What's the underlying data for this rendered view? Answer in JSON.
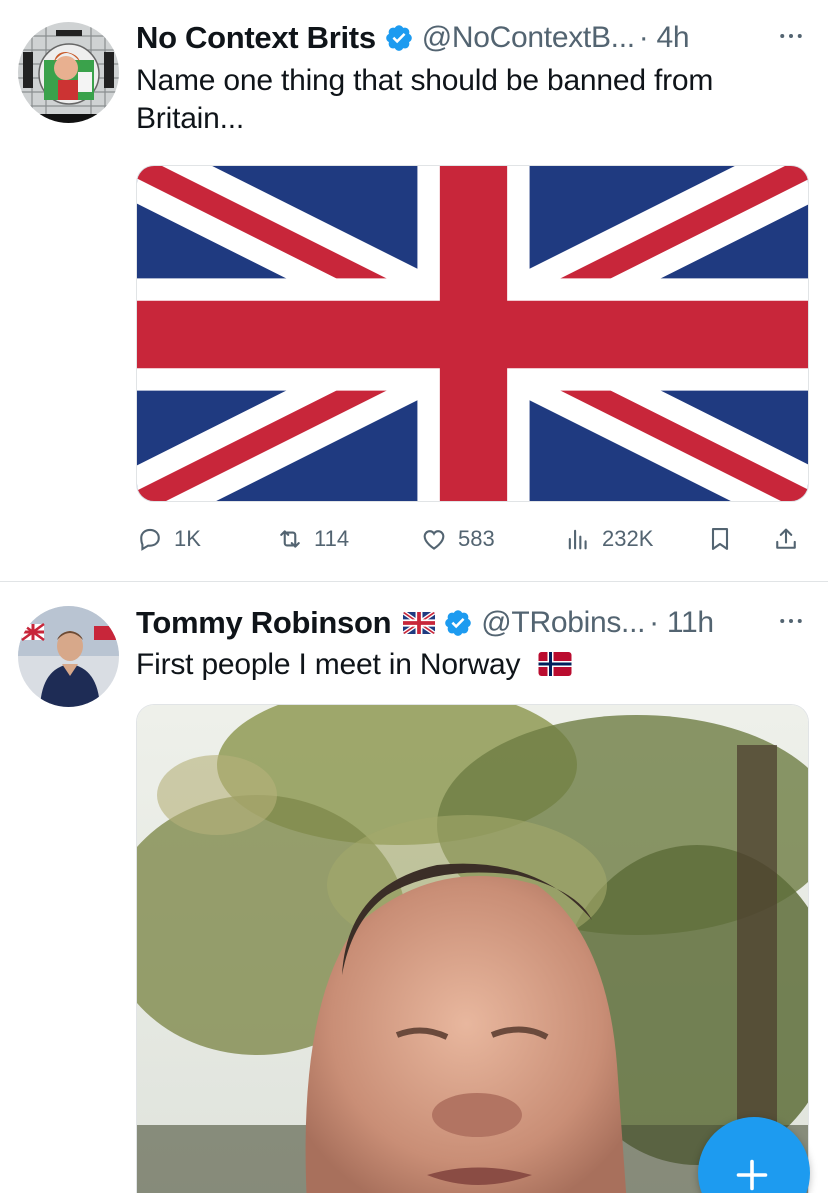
{
  "colors": {
    "text_primary": "#0f1419",
    "text_secondary": "#536471",
    "verified_blue": "#1d9bf0",
    "divider": "#e1e4e6",
    "fab_blue": "#1d9bf0"
  },
  "tweets": [
    {
      "author_name": "No Context Brits",
      "handle": "@NoContextB...",
      "time": "· 4h",
      "more_icon": "more-horizontal-icon",
      "verified_icon": "verified-badge-icon",
      "text": "Name one thing that should be banned from Britain...",
      "media": "union-jack-flag-image",
      "stats": {
        "replies": "1K",
        "retweets": "114",
        "likes": "583",
        "views": "232K"
      }
    },
    {
      "author_name": "Tommy Robinson",
      "name_emoji": "uk-flag-emoji",
      "handle": "@TRobins...",
      "time": "· 11h",
      "more_icon": "more-horizontal-icon",
      "verified_icon": "verified-badge-icon",
      "text": "First people I meet in Norway",
      "text_emoji": "norway-flag-emoji",
      "media": "video-selfie-under-trees"
    }
  ],
  "fab": {
    "icon": "plus-icon"
  }
}
